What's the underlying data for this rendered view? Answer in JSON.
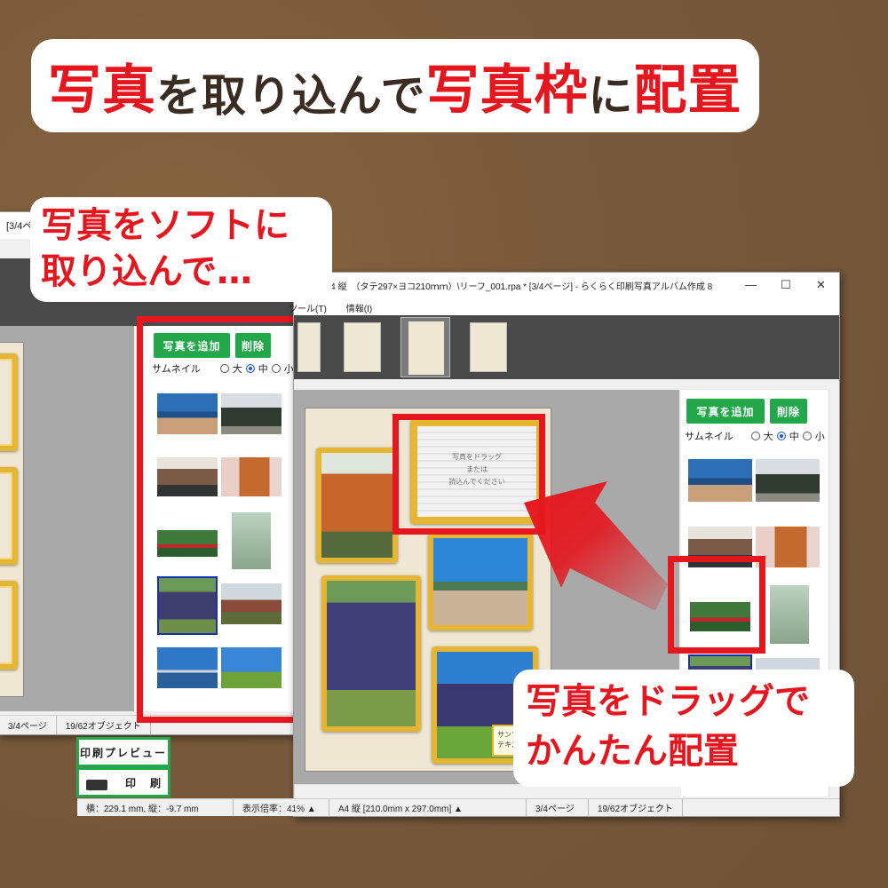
{
  "headline": {
    "part1": "写真",
    "part2": "を取り込んで",
    "part3": "写真枠",
    "part4": "に",
    "part5": "配置"
  },
  "callouts": {
    "import_line1": "写真をソフトに",
    "import_line2": "取り込んで…",
    "drag_line1": "写真をドラッグで",
    "drag_line2": "かんたん配置"
  },
  "back_window": {
    "title_fragment": "[3/4ペー",
    "add_photo": "写真を追加",
    "delete": "削除",
    "thumbnail_label": "サムネイル",
    "size_large": "大",
    "size_medium": "中",
    "size_small": "小",
    "status_page": "3/4ページ",
    "status_objects": "19/62オブジェクト",
    "print_preview": "印刷プレビュー",
    "print": "印　刷"
  },
  "main_window": {
    "title": "ns\\01A4 縦　（タテ297×ヨコ210ｍｍ）\\リーフ_001.rpa * [3/4ページ] - らくらく印刷写真アルバム作成 8",
    "minimize": "—",
    "maximize": "☐",
    "close": "✕",
    "menu_tool": "ツール(T)",
    "menu_info": "情報(I)",
    "add_photo": "写真を追加",
    "delete": "削除",
    "thumbnail_label": "サムネイル",
    "size_large": "大",
    "size_medium": "中",
    "size_small": "小",
    "placeholder_line1": "写真をドラッグ",
    "placeholder_line2": "または",
    "placeholder_line3": "読込んでください",
    "sample_label": "サンプル",
    "sample_label2": "テキスト",
    "status_coords": "横：229.1 mm, 縦：-9.7 mm",
    "status_zoom": "表示倍率：41% ▲",
    "status_paper": "A4 縦 [210.0mm x 297.0mm] ▲",
    "status_page": "3/4ページ",
    "status_objects": "19/62オブジェクト"
  },
  "colors": {
    "accent_red": "#e5161e",
    "button_green": "#22a84a",
    "frame_gold": "#e6b533",
    "background": "#7a5a3c"
  }
}
